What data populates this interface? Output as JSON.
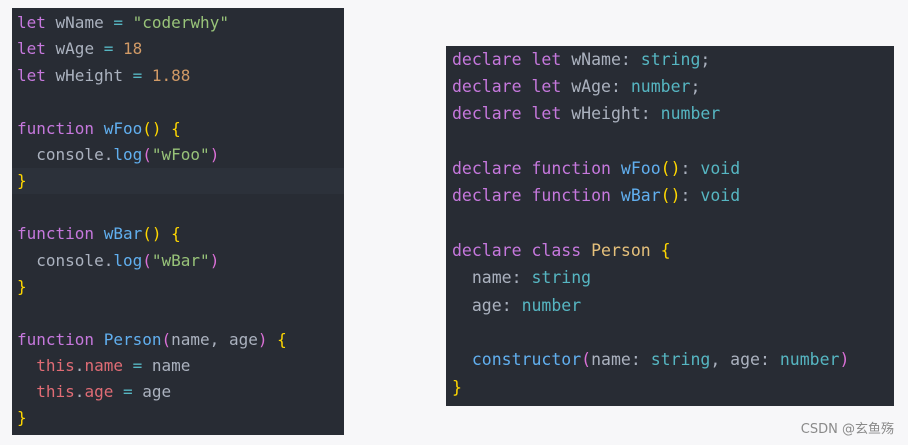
{
  "left": {
    "l1": {
      "a": "let",
      "b": " wName ",
      "c": "=",
      "d": " ",
      "e": "\"coderwhy\""
    },
    "l2": {
      "a": "let",
      "b": " wAge ",
      "c": "=",
      "d": " ",
      "e": "18"
    },
    "l3": {
      "a": "let",
      "b": " wHeight ",
      "c": "=",
      "d": " ",
      "e": "1.88"
    },
    "l5": {
      "a": "function",
      "b": " ",
      "c": "wFoo",
      "d": "()",
      "e": " ",
      "f": "{"
    },
    "l6": {
      "a": "console",
      "b": ".",
      "c": "log",
      "d": "(",
      "e": "\"wFoo\"",
      "f": ")"
    },
    "l7": {
      "a": "}"
    },
    "l9": {
      "a": "function",
      "b": " ",
      "c": "wBar",
      "d": "()",
      "e": " ",
      "f": "{"
    },
    "l10": {
      "a": "console",
      "b": ".",
      "c": "log",
      "d": "(",
      "e": "\"wBar\"",
      "f": ")"
    },
    "l11": {
      "a": "}"
    },
    "l13": {
      "a": "function",
      "b": " ",
      "c": "Person",
      "d": "(",
      "e": "name, age",
      "f": ")",
      "g": " ",
      "h": "{"
    },
    "l14": {
      "a": "this",
      "b": ".",
      "c": "name",
      "d": " ",
      "e": "=",
      "f": " name"
    },
    "l15": {
      "a": "this",
      "b": ".",
      "c": "age",
      "d": " ",
      "e": "=",
      "f": " age"
    },
    "l16": {
      "a": "}"
    }
  },
  "right": {
    "r1": {
      "a": "declare",
      "b": " ",
      "c": "let",
      "d": " wName: ",
      "e": "string",
      "f": ";"
    },
    "r2": {
      "a": "declare",
      "b": " ",
      "c": "let",
      "d": " wAge: ",
      "e": "number",
      "f": ";"
    },
    "r3": {
      "a": "declare",
      "b": " ",
      "c": "let",
      "d": " wHeight: ",
      "e": "number"
    },
    "r5": {
      "a": "declare",
      "b": " ",
      "c": "function",
      "d": " ",
      "e": "wFoo",
      "f": "()",
      "g": ": ",
      "h": "void"
    },
    "r6": {
      "a": "declare",
      "b": " ",
      "c": "function",
      "d": " ",
      "e": "wBar",
      "f": "()",
      "g": ": ",
      "h": "void"
    },
    "r8": {
      "a": "declare",
      "b": " ",
      "c": "class",
      "d": " ",
      "e": "Person",
      "f": " ",
      "g": "{"
    },
    "r9": {
      "a": "name",
      "b": ": ",
      "c": "string"
    },
    "r10": {
      "a": "age",
      "b": ": ",
      "c": "number"
    },
    "r12": {
      "a": "constructor",
      "b": "(",
      "c": "name: ",
      "d": "string",
      "e": ", age: ",
      "f": "number",
      "g": ")"
    },
    "r13": {
      "a": "}"
    }
  },
  "watermark": "CSDN @玄鱼殇"
}
